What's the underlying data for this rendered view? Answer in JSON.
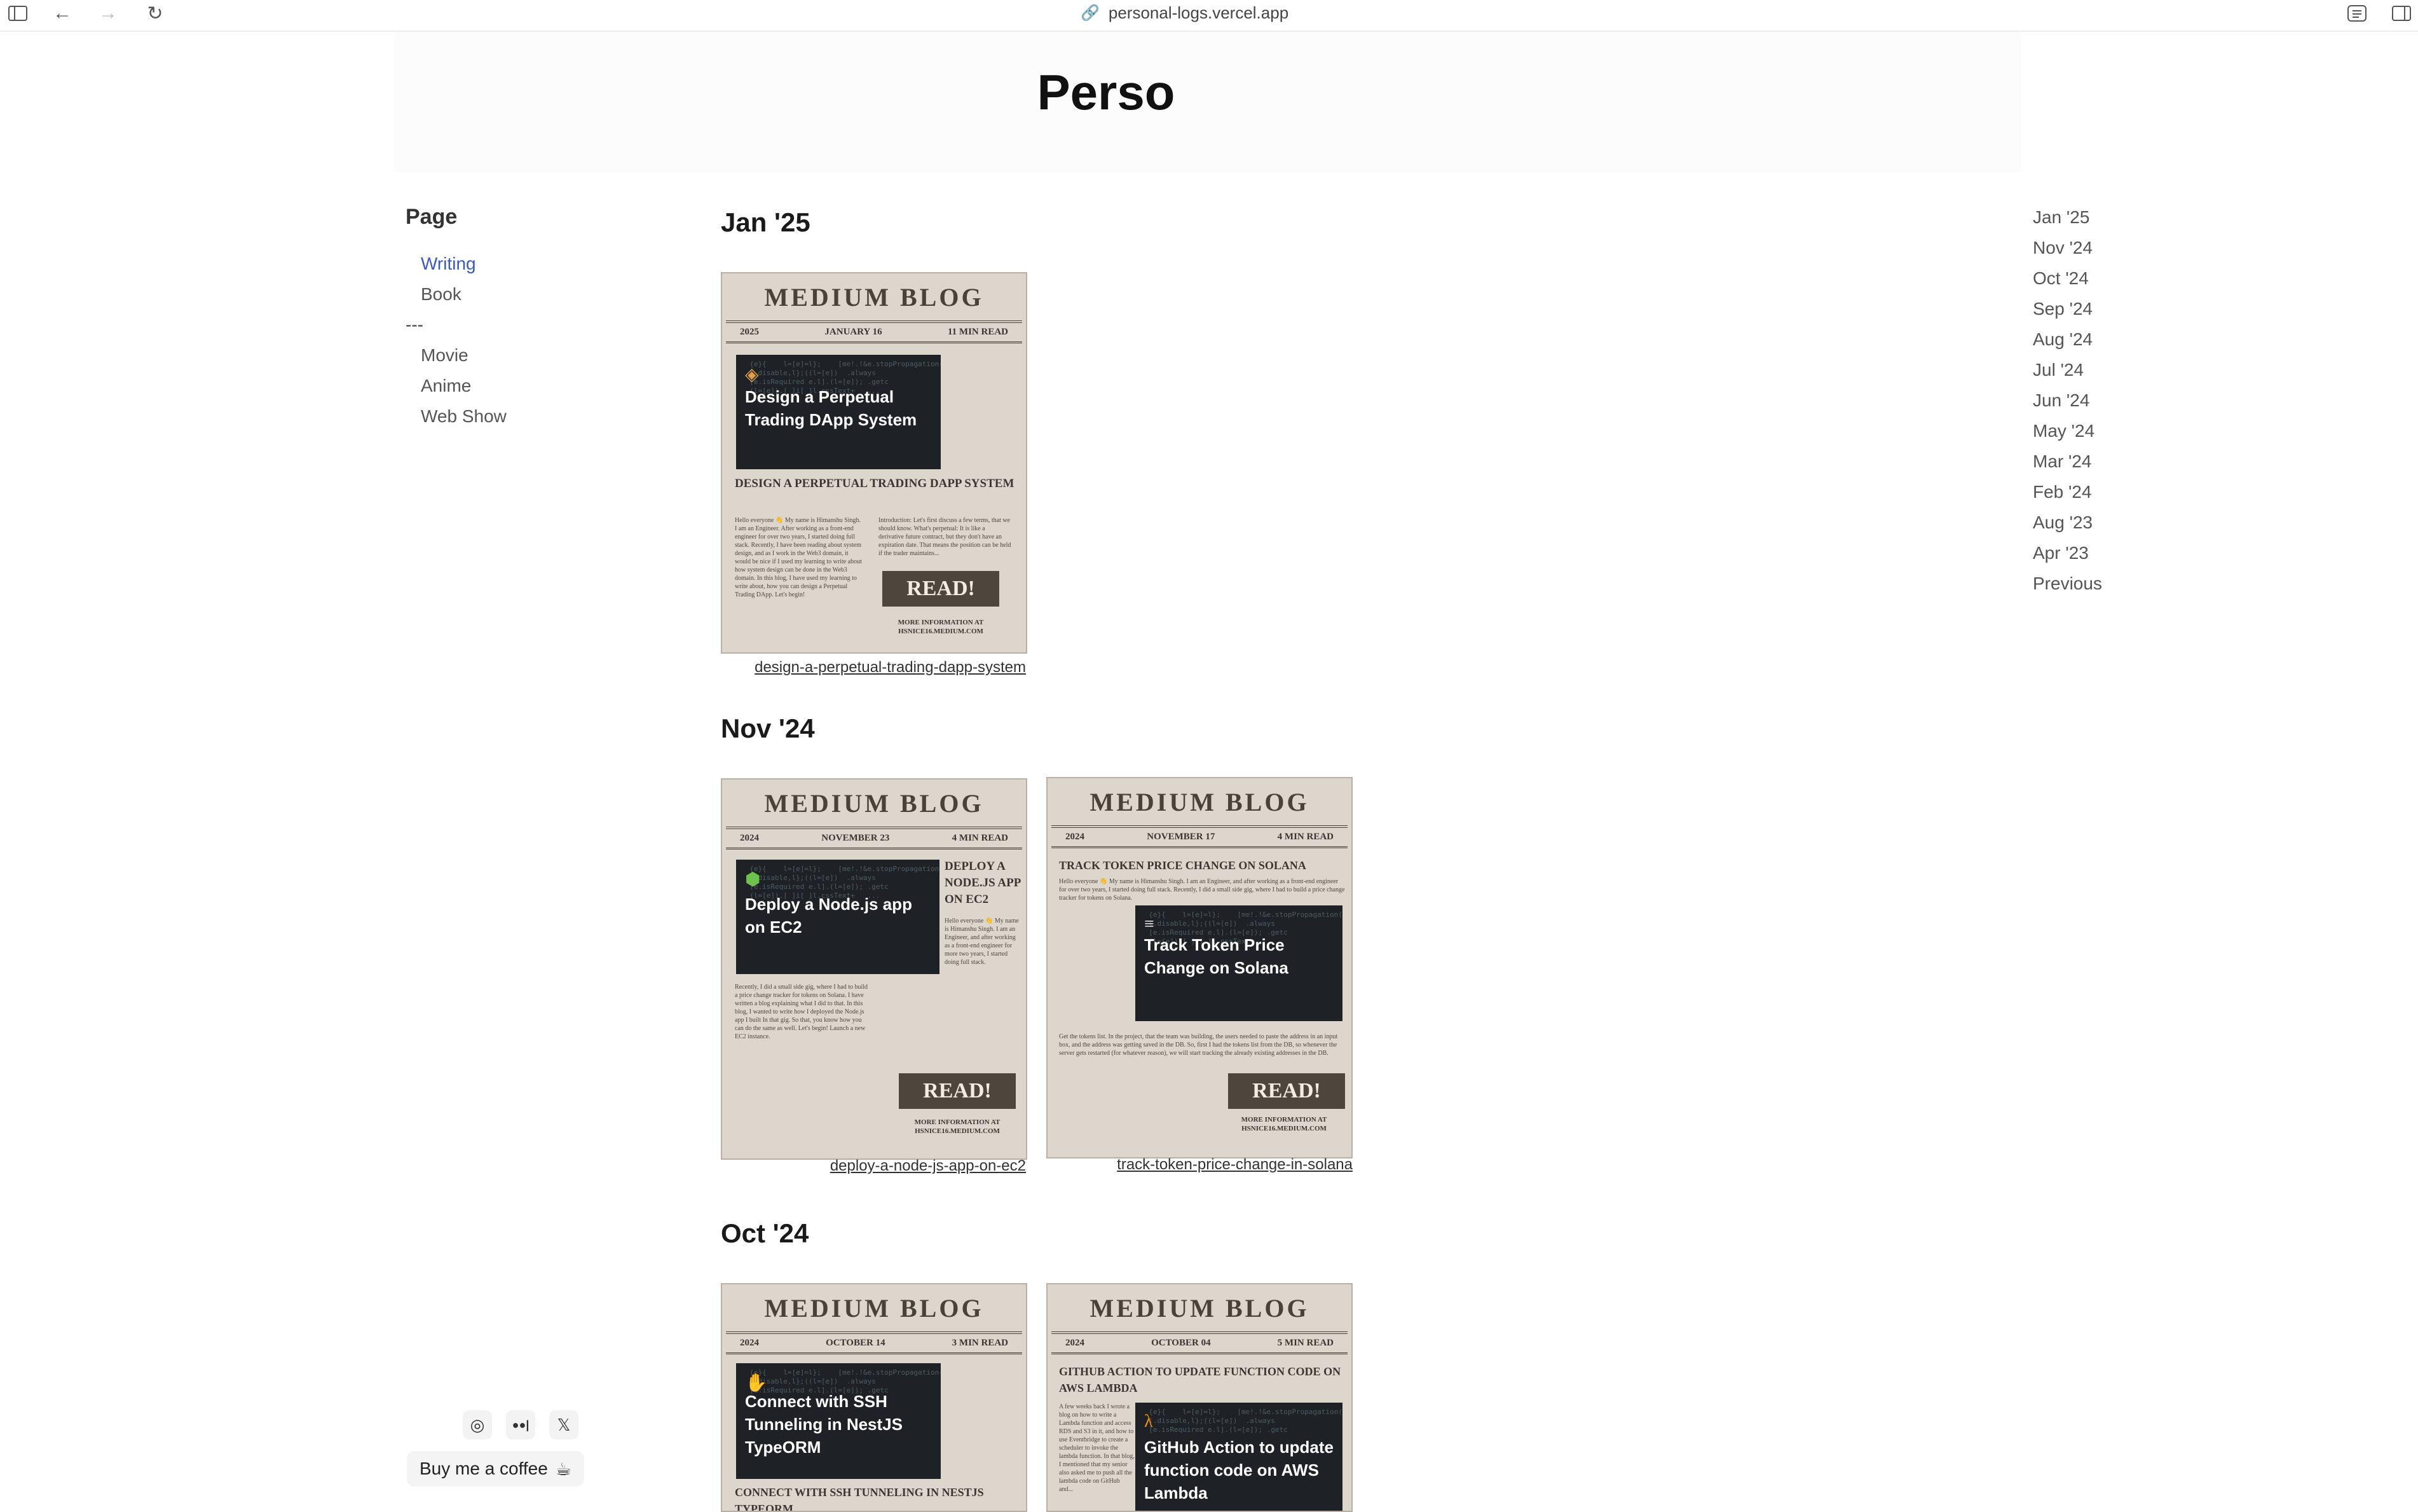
{
  "browser": {
    "url": "personal-logs.vercel.app"
  },
  "site": {
    "title": "Perso"
  },
  "sidebar": {
    "heading": "Page",
    "items_top": [
      {
        "label": "Writing",
        "active": true
      },
      {
        "label": "Book",
        "active": false
      }
    ],
    "separator": "---",
    "items_bottom": [
      {
        "label": "Movie"
      },
      {
        "label": "Anime"
      },
      {
        "label": "Web Show"
      }
    ]
  },
  "sections": [
    {
      "title": "Jan '25",
      "posts": [
        {
          "masthead": "MEDIUM BLOG",
          "year": "2025",
          "date": "JANUARY 16",
          "read": "11 MIN READ",
          "thumb_title": "Design a Perpetual Trading DApp System",
          "headline": "DESIGN A PERPETUAL TRADING  DAPP SYSTEM",
          "body": "Hello everyone 👋 My name is Himanshu Singh. I am an Engineer. After working as a front-end engineer for over two years, I started doing full stack. Recently, I have been reading about system design, and as I work in the Web3 domain, it would be nice if I used my learning to write about how system design can be done in the Web3 domain. In this blog, I have used my learning to write about, how you can design a Perpetual Trading DApp. Let's begin!",
          "body2": "Introduction: Let's first discuss a few terms, that we should know. What's perpetual: It is like a derivative future contract, but they don't have an expiration date. That means the position can be held if the trader maintains...",
          "read_label": "READ!",
          "more": "MORE INFORMATION AT HSNICE16.MEDIUM.COM",
          "slug": "design-a-perpetual-trading-dapp-system"
        }
      ]
    },
    {
      "title": "Nov '24",
      "posts": [
        {
          "masthead": "MEDIUM BLOG",
          "year": "2024",
          "date": "NOVEMBER 23",
          "read": "4 MIN READ",
          "thumb_title": "Deploy a Node.js app on EC2",
          "headline": "DEPLOY A NODE.JS APP ON EC2",
          "body": "Hello everyone 👋 My name is Himanshu Singh. I am an Engineer, and after working as a front-end engineer for more two years, I started doing full stack.",
          "body2": "Recently, I did a small side gig, where I had to build a price change tracker for tokens on Solana. I have written a blog explaining what I did to that. In this blog, I wanted to write how I deployed the Node.js app I built In that gig. So that, you know how you can do the same as well. Let's begin! Launch a new EC2 instance.",
          "read_label": "READ!",
          "more": "MORE INFORMATION AT HSNICE16.MEDIUM.COM",
          "slug": "deploy-a-node-js-app-on-ec2"
        },
        {
          "masthead": "MEDIUM BLOG",
          "year": "2024",
          "date": "NOVEMBER 17",
          "read": "4 MIN READ",
          "thumb_title": "Track Token Price Change on Solana",
          "headline": "TRACK TOKEN PRICE CHANGE ON SOLANA",
          "body": "Hello everyone 👋 My name is Himanshu Singh. I am an Engineer, and after working as a front-end engineer for over two years, I started doing full stack. Recently, I did a small side gig, where I had to build a price change tracker for tokens on Solana.",
          "body2": "Get the tokens list. In the project, that the team was building, the users needed to paste the address in an input box, and the address was getting saved in the DB. So, first I had the tokens list from the DB, so whenever the server gets restarted (for whatever reason), we will start tracking the already existing addresses in the DB.",
          "read_label": "READ!",
          "more": "MORE INFORMATION AT HSNICE16.MEDIUM.COM",
          "slug": "track-token-price-change-in-solana"
        }
      ]
    },
    {
      "title": "Oct '24",
      "posts": [
        {
          "masthead": "MEDIUM BLOG",
          "year": "2024",
          "date": "OCTOBER 14",
          "read": "3 MIN READ",
          "thumb_title": "Connect with SSH Tunneling in NestJS TypeORM",
          "headline": "CONNECT WITH SSH TUNNELING IN NESTJS TYPEORM",
          "slug": ""
        },
        {
          "masthead": "MEDIUM BLOG",
          "year": "2024",
          "date": "OCTOBER 04",
          "read": "5 MIN READ",
          "thumb_title": "GitHub Action to update function code on AWS Lambda",
          "headline": "GITHUB ACTION TO UPDATE FUNCTION CODE ON AWS LAMBDA",
          "body": "A few weeks back I wrote a blog on how to write a Lambda function and access RDS and S3 in it, and how to use Eventbridge to create a scheduler to invoke the lambda function. In that blog, I mentioned that my senior also asked me to push all the lambda code on GitHub and...",
          "slug": ""
        }
      ]
    }
  ],
  "timeline": [
    "Jan '25",
    "Nov '24",
    "Oct '24",
    "Sep '24",
    "Aug '24",
    "Jul '24",
    "Jun '24",
    "May '24",
    "Mar '24",
    "Feb '24",
    "Aug '23",
    "Apr '23",
    "Previous"
  ],
  "footer": {
    "socials": [
      {
        "icon": "instagram-icon",
        "glyph": "◎"
      },
      {
        "icon": "medium-icon",
        "glyph": "●●|"
      },
      {
        "icon": "x-icon",
        "glyph": "𝕏"
      }
    ],
    "coffee_label": "Buy me a coffee",
    "coffee_icon": "coffee-cup-icon"
  },
  "colors": {
    "accent": "#3a58c8",
    "card_bg": "#ddd6cc",
    "read_btn": "#4d463c"
  }
}
